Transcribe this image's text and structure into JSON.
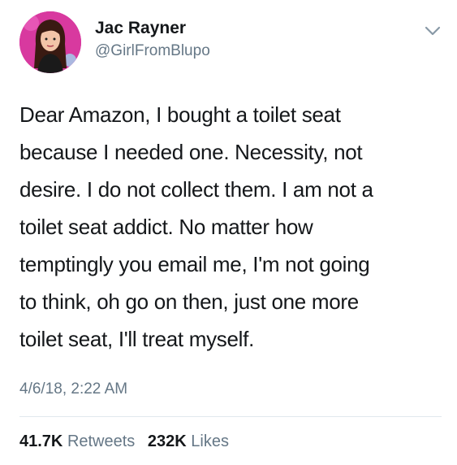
{
  "author": {
    "display_name": "Jac Rayner",
    "handle": "@GirlFromBlupo",
    "avatar_icon": "profile-photo-avatar"
  },
  "menu_icon": "chevron-down-icon",
  "tweet": {
    "lines": [
      "Dear Amazon, I bought a toilet seat",
      "because I needed one. Necessity, not",
      "desire. I do not collect them. I am not a",
      "toilet seat addict. No matter how",
      "temptingly you email me, I'm not going",
      "to think, oh go on then, just one more",
      "toilet seat, I'll treat myself."
    ],
    "timestamp": "4/6/18, 2:22 AM"
  },
  "stats": {
    "retweets_count": "41.7K",
    "retweets_label": "Retweets",
    "likes_count": "232K",
    "likes_label": "Likes"
  },
  "colors": {
    "text": "#14171a",
    "secondary": "#657786",
    "divider": "#e1e8ed"
  }
}
